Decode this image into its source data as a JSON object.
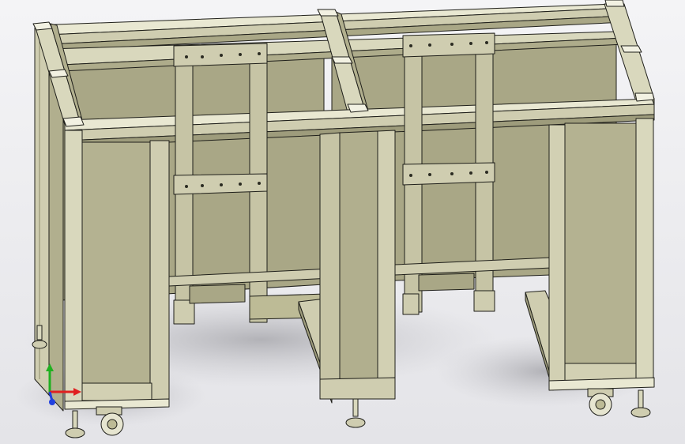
{
  "viewport": {
    "kind": "3d-cad-model-view",
    "background_top": "#f4f4f6",
    "background_bottom": "#e6e6ea"
  },
  "model": {
    "face_color": "#bdbb96",
    "face_light": "#e9e8d2",
    "face_dark": "#8c8a6a",
    "edge_color": "#1f1f1a",
    "shadow_color": "#b8b8bc",
    "components": [
      "frame",
      "panels",
      "cross-beams",
      "bolt-plates",
      "casters",
      "leveling-feet"
    ]
  },
  "triad": {
    "axes": [
      "x-axis",
      "y-axis",
      "z-axis"
    ],
    "x_color": "#e02020",
    "y_color": "#20b020",
    "z_color": "#2040e0"
  }
}
